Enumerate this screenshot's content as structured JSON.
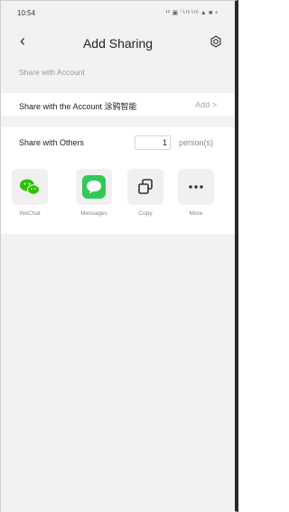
{
  "status_bar": {
    "time": "10:54",
    "icons": "¹² ▣ ⁱ ᴸᵗᵉ ᴸᵗᵉ ▲ ■ +"
  },
  "header": {
    "title": "Add Sharing",
    "back_icon": "chevron-left",
    "settings_icon": "settings"
  },
  "share_account": {
    "section_label": "Share with Account",
    "row_label": "Share with the Account 涂鸦智能",
    "action": "Add >"
  },
  "share_others": {
    "label": "Share with Others",
    "count": "1",
    "unit": "person(s)",
    "options": [
      {
        "label": "WeChat",
        "icon": "wechat-icon"
      },
      {
        "label": "Messages",
        "icon": "messages-icon"
      },
      {
        "label": "Copy",
        "icon": "copy-icon"
      },
      {
        "label": "More",
        "icon": "more-icon"
      }
    ]
  },
  "colors": {
    "wechat": "#2dc100",
    "messages": "#34c759",
    "background": "#f2f2f2"
  }
}
